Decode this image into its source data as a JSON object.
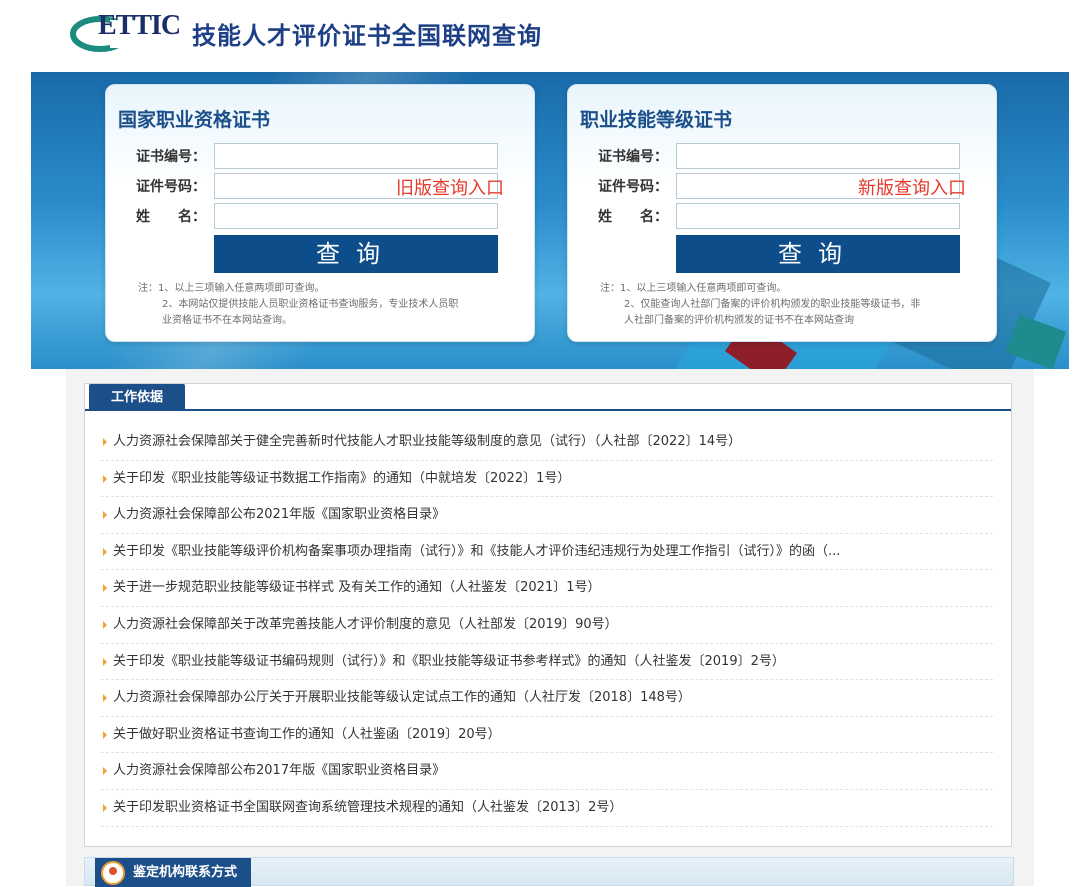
{
  "header": {
    "logo_text": "ETTIC",
    "title": "技能人才评价证书全国联网查询"
  },
  "cards": [
    {
      "title": "国家职业资格证书",
      "fields": [
        {
          "label": "证书编号：",
          "value": "",
          "placeholder": ""
        },
        {
          "label": "证件号码：",
          "value": "",
          "placeholder": ""
        },
        {
          "label": "姓　　名：",
          "value": "",
          "placeholder": ""
        }
      ],
      "overlay": "旧版查询入口",
      "button": "查询",
      "notes": [
        "注：1、以上三项输入任意两项即可查询。",
        "2、本网站仅提供技能人员职业资格证书查询服务，专业技术人员职",
        "业资格证书不在本网站查询。"
      ]
    },
    {
      "title": "职业技能等级证书",
      "fields": [
        {
          "label": "证书编号：",
          "value": "",
          "placeholder": ""
        },
        {
          "label": "证件号码：",
          "value": "",
          "placeholder": ""
        },
        {
          "label": "姓　　名：",
          "value": "",
          "placeholder": ""
        }
      ],
      "overlay": "新版查询入口",
      "button": "查询",
      "notes": [
        "注：1、以上三项输入任意两项即可查询。",
        "2、仅能查询人社部门备案的评价机构颁发的职业技能等级证书，非",
        "人社部门备案的评价机构颁发的证书不在本网站查询"
      ]
    }
  ],
  "work_basis": {
    "tab": "工作依据",
    "items": [
      "人力资源社会保障部关于健全完善新时代技能人才职业技能等级制度的意见（试行）（人社部〔2022〕14号）",
      "关于印发《职业技能等级证书数据工作指南》的通知（中就培发〔2022〕1号）",
      "人力资源社会保障部公布2021年版《国家职业资格目录》",
      "关于印发《职业技能等级评价机构备案事项办理指南（试行）》和《技能人才评价违纪违规行为处理工作指引（试行）》的函（...",
      "关于进一步规范职业技能等级证书样式 及有关工作的通知（人社鉴发〔2021〕1号）",
      "人力资源社会保障部关于改革完善技能人才评价制度的意见（人社部发〔2019〕90号）",
      "关于印发《职业技能等级证书编码规则（试行）》和《职业技能等级证书参考样式》的通知（人社鉴发〔2019〕2号）",
      "人力资源社会保障部办公厅关于开展职业技能等级认定试点工作的通知（人社厅发〔2018〕148号）",
      "关于做好职业资格证书查询工作的通知（人社鉴函〔2019〕20号）",
      "人力资源社会保障部公布2017年版《国家职业资格目录》",
      "关于印发职业资格证书全国联网查询系统管理技术规程的通知（人社鉴发〔2013〕2号）"
    ]
  },
  "contact": {
    "tab": "鉴定机构联系方式"
  },
  "colors": {
    "brand_blue": "#1c4f8a",
    "button_blue": "#0d4d8a",
    "overlay_red": "#e43b2c",
    "bullet_orange": "#f0a030"
  }
}
